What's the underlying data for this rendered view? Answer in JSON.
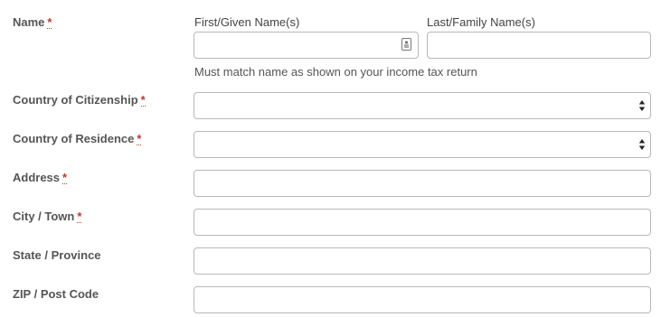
{
  "form": {
    "name": {
      "label": "Name",
      "required_mark": "*",
      "first_label": "First/Given Name(s)",
      "first_value": "",
      "last_label": "Last/Family Name(s)",
      "last_value": "",
      "hint": "Must match name as shown on your income tax return"
    },
    "citizenship": {
      "label": "Country of Citizenship",
      "required_mark": "*",
      "selected": ""
    },
    "residence": {
      "label": "Country of Residence",
      "required_mark": "*",
      "selected": ""
    },
    "address": {
      "label": "Address",
      "required_mark": "*",
      "value": ""
    },
    "city": {
      "label": "City / Town",
      "required_mark": "*",
      "value": ""
    },
    "state": {
      "label": "State / Province",
      "value": ""
    },
    "zip": {
      "label": "ZIP / Post Code",
      "value": ""
    }
  },
  "icons": {
    "name_autofill": "contact-card-icon",
    "select_arrows": "up-down-arrows-icon"
  },
  "colors": {
    "label_text": "#555555",
    "required_mark": "#c0392b",
    "field_border": "#b8b8b8"
  }
}
